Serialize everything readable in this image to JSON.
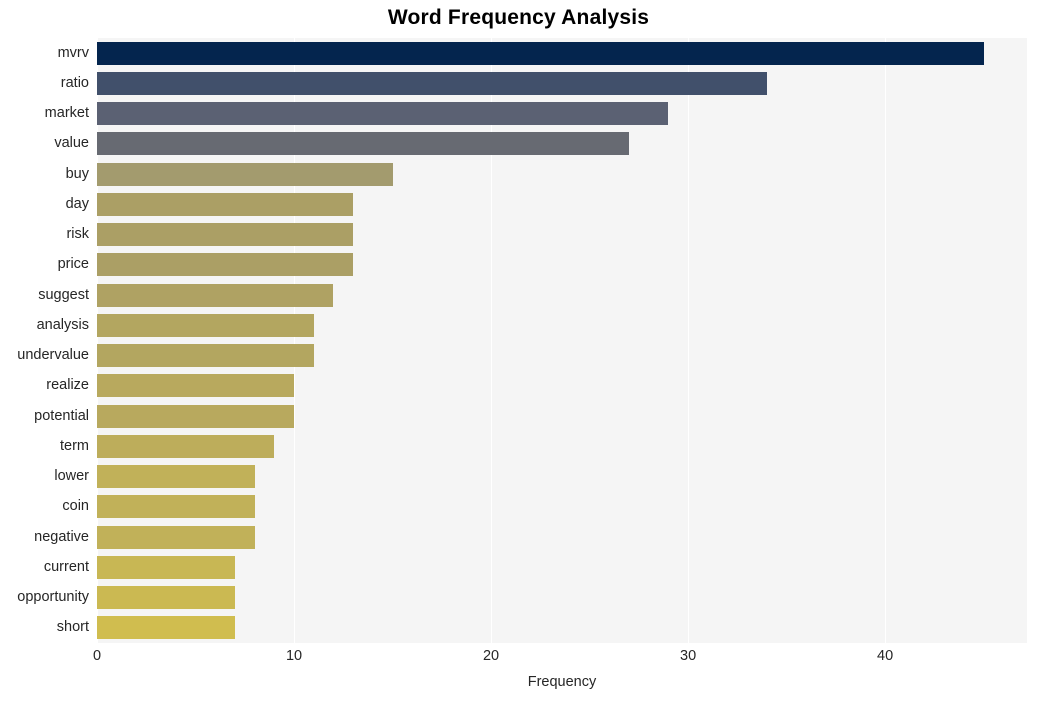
{
  "chart_data": {
    "type": "bar",
    "orientation": "horizontal",
    "title": "Word Frequency Analysis",
    "xlabel": "Frequency",
    "ylabel": "",
    "categories": [
      "mvrv",
      "ratio",
      "market",
      "value",
      "buy",
      "day",
      "risk",
      "price",
      "suggest",
      "analysis",
      "undervalue",
      "realize",
      "potential",
      "term",
      "lower",
      "coin",
      "negative",
      "current",
      "opportunity",
      "short"
    ],
    "values": [
      45,
      34,
      29,
      27,
      15,
      13,
      13,
      13,
      12,
      11,
      11,
      10,
      10,
      9,
      8,
      8,
      8,
      7,
      7,
      7
    ],
    "bar_colors": [
      "#04254e",
      "#41506b",
      "#5b6173",
      "#676a72",
      "#a39b6e",
      "#ab9f65",
      "#ab9f65",
      "#ab9f65",
      "#afa263",
      "#b3a660",
      "#b3a660",
      "#b8a95e",
      "#b8a95e",
      "#bdad5b",
      "#c1b159",
      "#c1b159",
      "#c1b159",
      "#c8b754",
      "#cbb952",
      "#d0bd4f"
    ],
    "xticks": [
      0,
      10,
      20,
      30,
      40
    ],
    "xtick_labels": [
      "0",
      "10",
      "20",
      "30",
      "40"
    ],
    "xlim": [
      0,
      47.2
    ],
    "grid": true,
    "grid_axis": "x",
    "plot_background": "#f5f5f5",
    "figure_background": "#ffffff",
    "title_color": "#000000",
    "tick_color": "#262626"
  }
}
